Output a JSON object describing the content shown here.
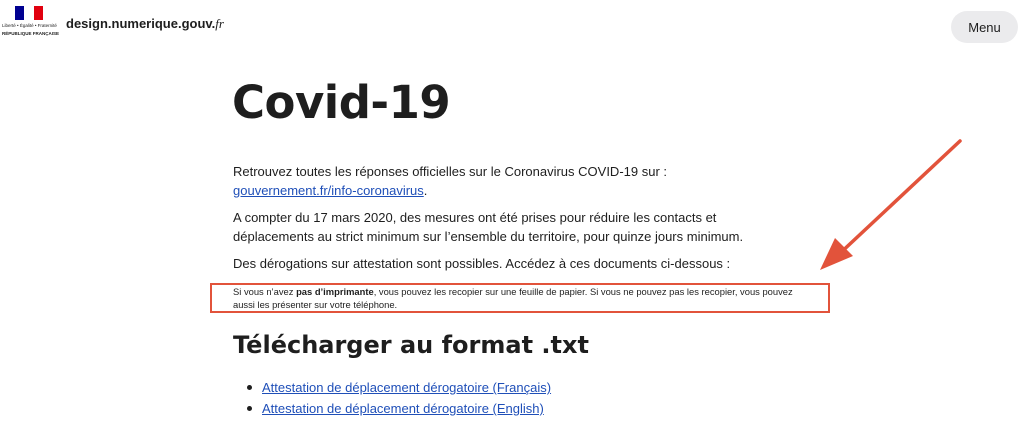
{
  "header": {
    "logo_text": "Liberté • Égalité • Fraternité",
    "logo_subtext": "RÉPUBLIQUE FRANÇAISE",
    "site_name_main": "design.numerique.gouv.",
    "site_name_suffix": "fr",
    "menu_label": "Menu"
  },
  "colors": {
    "flag_blue": "#000091",
    "flag_red": "#e1000f",
    "link": "#1f4fb8",
    "highlight": "#e2533b"
  },
  "main": {
    "title": "Covid-19",
    "p1_text": "Retrouvez toutes les réponses officielles sur le Coronavirus COVID-19 sur : ",
    "p1_link": "gouvernement.fr/info-coronavirus",
    "p1_end": ".",
    "p2": "A compter du 17 mars 2020, des mesures ont été prises pour réduire les contacts et déplacements au strict minimum sur l’ensemble du territoire, pour quinze jours minimum.",
    "p3": "Des dérogations sur attestation sont possibles. Accédez à ces documents ci-dessous :",
    "note_prefix": "Si vous n’avez ",
    "note_bold": "pas d’imprimante",
    "note_rest": ", vous pouvez les recopier sur une feuille de papier. Si vous ne pouvez pas les recopier, vous pouvez aussi les présenter sur votre téléphone.",
    "subtitle": "Télécharger au format .txt",
    "downloads": [
      "Attestation de déplacement dérogatoire (Français)",
      "Attestation de déplacement dérogatoire (English)"
    ]
  }
}
